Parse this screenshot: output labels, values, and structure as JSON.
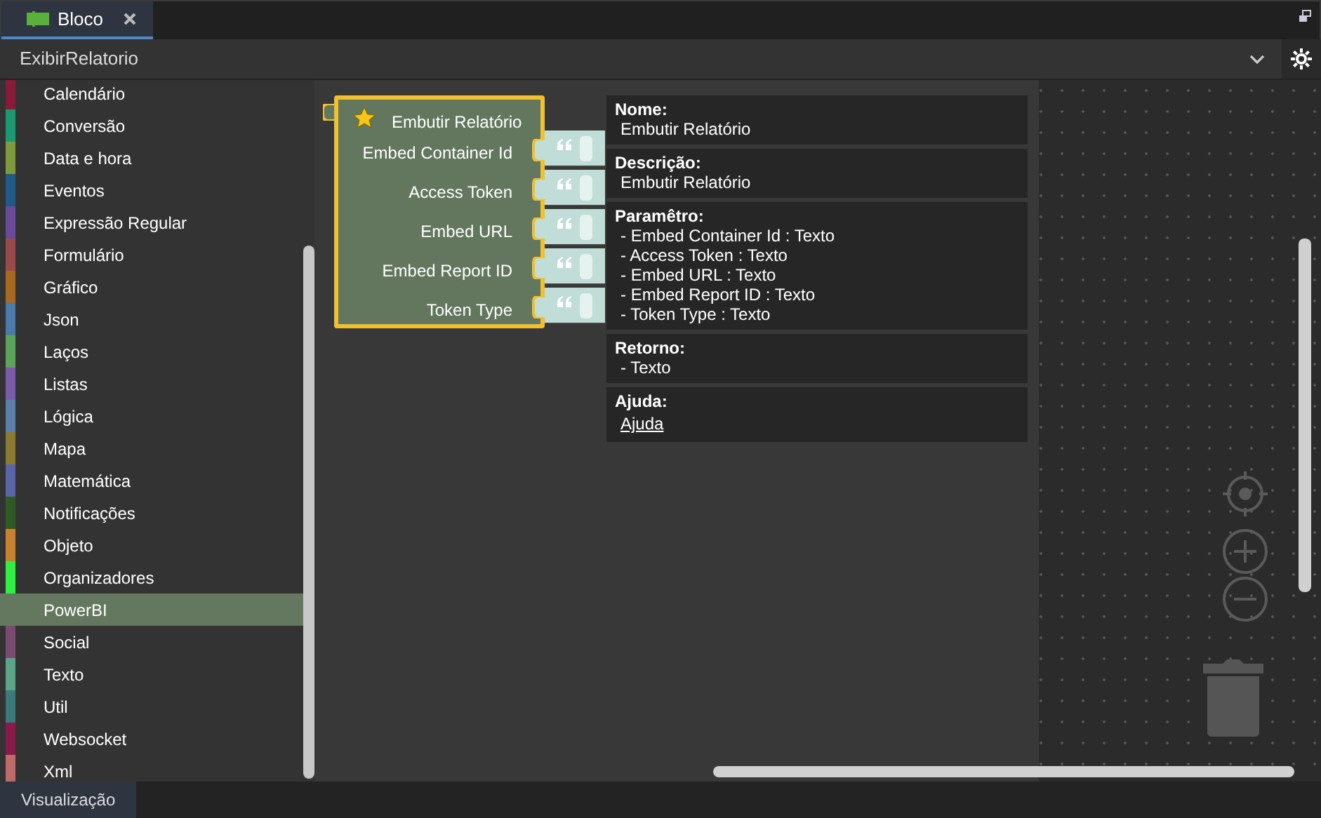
{
  "tab": {
    "label": "Bloco",
    "selected": true
  },
  "dropdown": {
    "value": "ExibirRelatorio"
  },
  "categories": [
    {
      "label": "Calendário",
      "color": "#8b1a3a",
      "selected": false
    },
    {
      "label": "Conversão",
      "color": "#1a9a70",
      "selected": false
    },
    {
      "label": "Data e hora",
      "color": "#7f9a3a",
      "selected": false
    },
    {
      "label": "Eventos",
      "color": "#1e5a8a",
      "selected": false
    },
    {
      "label": "Expressão Regular",
      "color": "#6a4a9a",
      "selected": false
    },
    {
      "label": "Formulário",
      "color": "#9a4a4a",
      "selected": false
    },
    {
      "label": "Gráfico",
      "color": "#a8681e",
      "selected": false
    },
    {
      "label": "Json",
      "color": "#4a7aaa",
      "selected": false
    },
    {
      "label": "Laços",
      "color": "#5aa55a",
      "selected": false
    },
    {
      "label": "Listas",
      "color": "#7a5aaa",
      "selected": false
    },
    {
      "label": "Lógica",
      "color": "#5a80aa",
      "selected": false
    },
    {
      "label": "Mapa",
      "color": "#8a7a30",
      "selected": false
    },
    {
      "label": "Matemática",
      "color": "#5a64a8",
      "selected": false
    },
    {
      "label": "Notificações",
      "color": "#2f5a24",
      "selected": false
    },
    {
      "label": "Objeto",
      "color": "#c8822e",
      "selected": false
    },
    {
      "label": "Organizadores",
      "color": "#2ef040",
      "selected": false
    },
    {
      "label": "PowerBI",
      "selected": true
    },
    {
      "label": "Social",
      "color": "#7a4a70",
      "selected": false
    },
    {
      "label": "Texto",
      "color": "#5aa58a",
      "selected": false
    },
    {
      "label": "Util",
      "color": "#3a7a7a",
      "selected": false
    },
    {
      "label": "Websocket",
      "color": "#8a1a4a",
      "selected": false
    },
    {
      "label": "Xml",
      "color": "#c06a6a",
      "selected": false
    }
  ],
  "block": {
    "title": "Embutir Relatório",
    "inputs": [
      {
        "label": "Embed Container Id"
      },
      {
        "label": "Access Token"
      },
      {
        "label": "Embed URL"
      },
      {
        "label": "Embed Report ID"
      },
      {
        "label": "Token Type"
      }
    ]
  },
  "info": [
    {
      "heading": "Nome:",
      "kind": "text",
      "lines": [
        "Embutir Relatório"
      ]
    },
    {
      "heading": "Descrição:",
      "kind": "text",
      "lines": [
        "Embutir Relatório"
      ]
    },
    {
      "heading": "Paramêtro:",
      "kind": "text",
      "lines": [
        "- Embed Container Id : Texto",
        "- Access Token : Texto",
        "- Embed URL : Texto",
        "- Embed Report ID : Texto",
        "- Token Type : Texto"
      ]
    },
    {
      "heading": "Retorno:",
      "kind": "text",
      "lines": [
        "- Texto"
      ]
    },
    {
      "heading": "Ajuda:",
      "kind": "link",
      "lines": [
        "Ajuda"
      ]
    }
  ],
  "bottom_tab": {
    "label": "Visualização"
  }
}
